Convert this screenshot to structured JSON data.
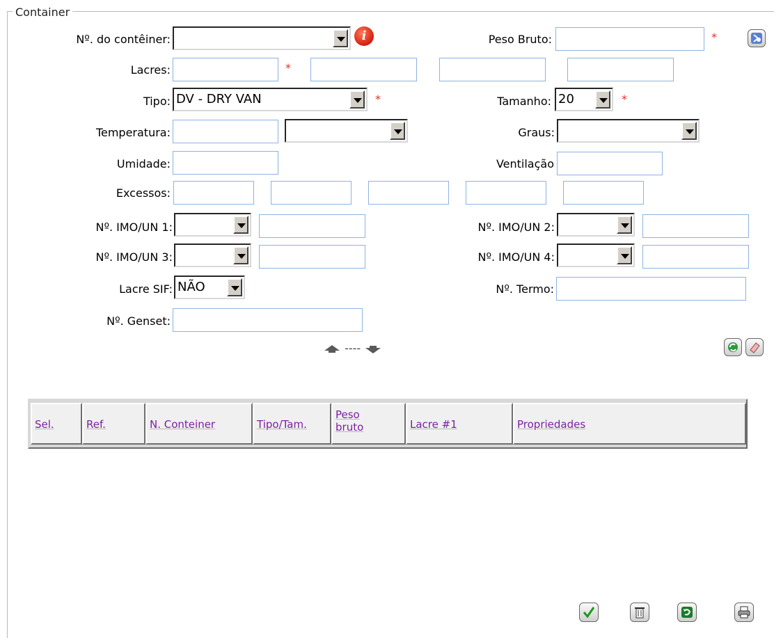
{
  "legend": "Container",
  "required_marker": "*",
  "info_icon_glyph": "i",
  "labels": {
    "container_no": "Nº. do contêiner:",
    "peso_bruto": "Peso Bruto:",
    "lacres": "Lacres:",
    "tipo": "Tipo:",
    "tamanho": "Tamanho:",
    "temperatura": "Temperatura:",
    "graus": "Graus:",
    "umidade": "Umidade:",
    "ventilacao": "Ventilação",
    "excessos": "Excessos:",
    "imo1": "Nº. IMO/UN 1:",
    "imo2": "Nº. IMO/UN 2:",
    "imo3": "Nº. IMO/UN 3:",
    "imo4": "Nº. IMO/UN 4:",
    "lacre_sif": "Lacre SIF:",
    "termo": "Nº. Termo:",
    "genset": "Nº. Genset:"
  },
  "values": {
    "tipo": "DV - DRY VAN",
    "tamanho": "20",
    "lacre_sif": "NÃO"
  },
  "reorder_separator": "----",
  "grid": {
    "columns": [
      "Sel.",
      "Ref.",
      "N. Conteiner",
      "Tipo/Tam.",
      "Peso bruto",
      "Lacre #1",
      "Propriedades"
    ]
  },
  "icons": [
    "info-icon",
    "lookup-icon",
    "arrow-up-icon",
    "arrow-down-icon",
    "refresh-icon",
    "eraser-icon",
    "confirm-icon",
    "delete-icon",
    "undo-icon",
    "print-icon"
  ],
  "colors": {
    "input_border": "#8db2e3",
    "required": "#e0302a",
    "grid_header_text": "#7b1fa2",
    "confirm_green": "#1c9a1c"
  }
}
